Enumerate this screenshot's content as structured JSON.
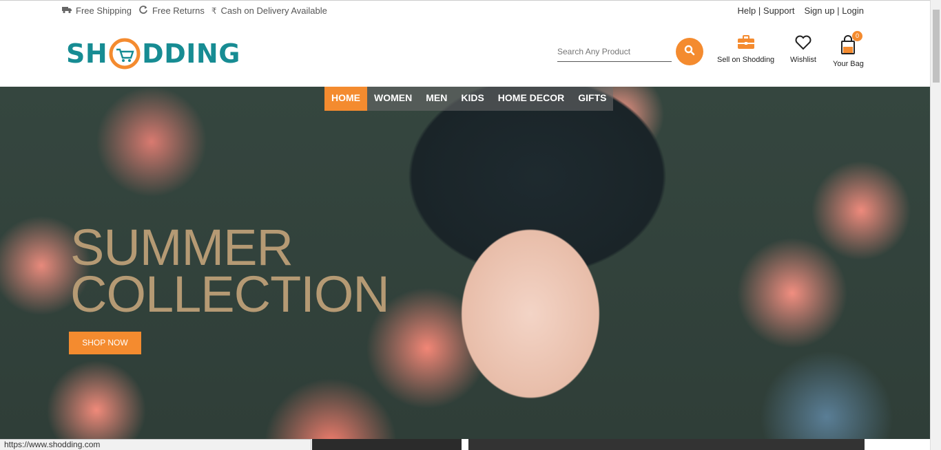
{
  "topbar": {
    "features": [
      {
        "icon": "truck-icon",
        "label": "Free Shipping"
      },
      {
        "icon": "refresh-icon",
        "label": "Free Returns"
      },
      {
        "icon": "rupee-icon",
        "label": "Cash on Delivery Available"
      }
    ],
    "help": "Help",
    "support": "Support",
    "signup": "Sign up",
    "login": "Login",
    "sep": "|"
  },
  "header": {
    "logo_left": "SH",
    "logo_right": "DDING",
    "search_placeholder": "Search Any Product",
    "sell_label": "Sell on Shodding",
    "wishlist_label": "Wishlist",
    "bag_label": "Your Bag",
    "bag_count": "0"
  },
  "nav": {
    "tabs": [
      "HOME",
      "WOMEN",
      "MEN",
      "KIDS",
      "HOME DECOR",
      "GIFTS"
    ],
    "active": "HOME"
  },
  "hero": {
    "title_line1": "SUMMER",
    "title_line2": "COLLECTION",
    "cta": "SHOP NOW"
  },
  "status_url": "https://www.shodding.com",
  "colors": {
    "accent": "#f48b2f",
    "brand": "#178c93",
    "hero_title": "#b59a74"
  }
}
